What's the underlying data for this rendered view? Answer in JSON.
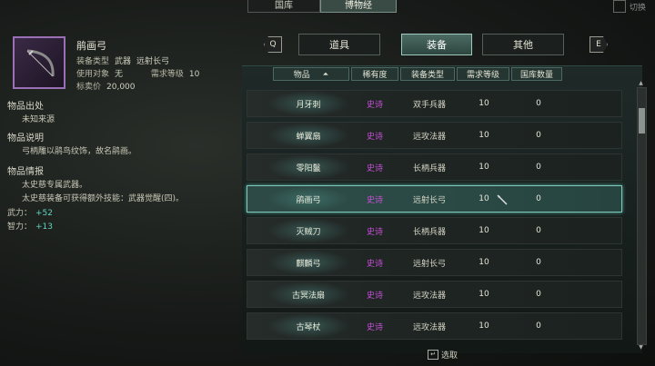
{
  "top_tabs": [
    {
      "label": "国库",
      "active": false
    },
    {
      "label": "博物经",
      "active": true
    }
  ],
  "corner_hint": "切换",
  "item": {
    "name": "鹃画弓",
    "equip_type_label": "装备类型",
    "equip_type_value": "武器",
    "equip_sub": "远射长弓",
    "user_label": "使用对象",
    "user_value": "无",
    "req_level_label": "需求等级",
    "req_level_value": "10",
    "price_label": "标卖价",
    "price_value": "20,000"
  },
  "sections": {
    "origin_title": "物品出处",
    "origin_text": "未知来源",
    "desc_title": "物品说明",
    "desc_text": "弓柄雕以鹃鸟纹饰，故名鹃画。",
    "info_title": "物品情报",
    "info_line1": "太史慈专属武器。",
    "info_line2": "太史慈装备可获得额外技能：武器觉醒(四)。",
    "stat1_label": "武力：",
    "stat1_value": "+52",
    "stat2_label": "智力：",
    "stat2_value": "+13"
  },
  "category_tabs": [
    {
      "label": "道具",
      "active": false
    },
    {
      "label": "装备",
      "active": true
    },
    {
      "label": "其他",
      "active": false
    }
  ],
  "key_hints": {
    "left": "Q",
    "right": "E"
  },
  "columns": [
    "物品",
    "稀有度",
    "装备类型",
    "需求等级",
    "国库数量"
  ],
  "rows": [
    {
      "name": "月牙刺",
      "rarity": "史诗",
      "type": "双手兵器",
      "level": "10",
      "qty": "0"
    },
    {
      "name": "蝉翼扇",
      "rarity": "史诗",
      "type": "远攻法器",
      "level": "10",
      "qty": "0"
    },
    {
      "name": "零阳鬣",
      "rarity": "史诗",
      "type": "长柄兵器",
      "level": "10",
      "qty": "0"
    },
    {
      "name": "鹃画弓",
      "rarity": "史诗",
      "type": "远射长弓",
      "level": "10",
      "qty": "0",
      "selected": true
    },
    {
      "name": "灭贼刀",
      "rarity": "史诗",
      "type": "长柄兵器",
      "level": "10",
      "qty": "0"
    },
    {
      "name": "麒麟弓",
      "rarity": "史诗",
      "type": "远射长弓",
      "level": "10",
      "qty": "0"
    },
    {
      "name": "古冥法扇",
      "rarity": "史诗",
      "type": "远攻法器",
      "level": "10",
      "qty": "0"
    },
    {
      "name": "古琴杖",
      "rarity": "史诗",
      "type": "远攻法器",
      "level": "10",
      "qty": "0"
    }
  ],
  "footer": {
    "select_label": "选取"
  },
  "colors": {
    "rarity_epic": "#c84fd8",
    "accent": "#7fc8bb",
    "stat_plus": "#5fd4c0"
  }
}
